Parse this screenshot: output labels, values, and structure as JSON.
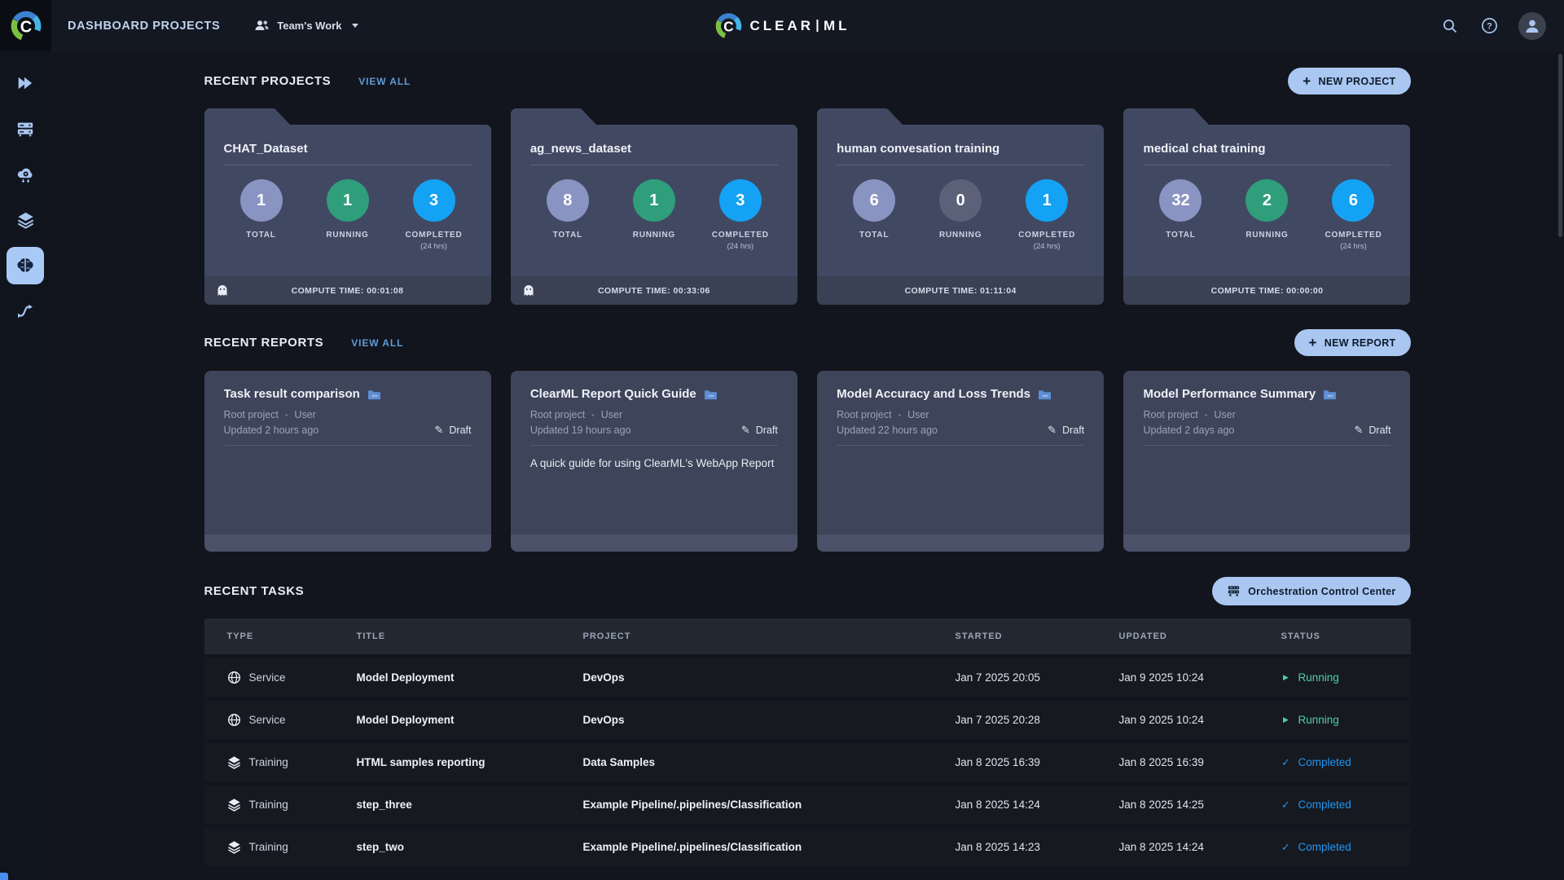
{
  "topbar": {
    "page_title": "DASHBOARD PROJECTS",
    "workspace": {
      "label": "Team's Work",
      "icon": "people-icon",
      "caret": "chevron-down-icon"
    },
    "logo": {
      "icon": "clearml-logo-icon",
      "text_left": "CLEAR",
      "text_right": "ML"
    },
    "icons": {
      "search": "search-icon",
      "help": "help-icon",
      "avatar": "user-avatar-icon"
    }
  },
  "sidebar": {
    "items": [
      {
        "name": "getting-started",
        "icon": "double-play-icon",
        "active": false
      },
      {
        "name": "workers-queues",
        "icon": "server-rack-icon",
        "active": false
      },
      {
        "name": "applications",
        "icon": "cloud-gear-icon",
        "active": false
      },
      {
        "name": "datasets",
        "icon": "layers-icon",
        "active": false
      },
      {
        "name": "models",
        "icon": "brain-icon",
        "active": true
      },
      {
        "name": "pipelines",
        "icon": "pipeline-icon",
        "active": false
      }
    ]
  },
  "projects": {
    "title": "RECENT PROJECTS",
    "view_all": "VIEW ALL",
    "new_button": "NEW PROJECT",
    "plus_icon": "plus-icon",
    "ghost_icon": "ghost-icon",
    "labels": {
      "total": "TOTAL",
      "running": "RUNNING",
      "completed": "COMPLETED",
      "completed_note": "(24 hrs)"
    },
    "cards": [
      {
        "title": "CHAT_Dataset",
        "total": "1",
        "running": "1",
        "completed": "3",
        "compute_time": "COMPUTE TIME: 00:01:08",
        "ghost": true
      },
      {
        "title": "ag_news_dataset",
        "total": "8",
        "running": "1",
        "completed": "3",
        "compute_time": "COMPUTE TIME: 00:33:06",
        "ghost": true
      },
      {
        "title": "human convesation training",
        "total": "6",
        "running": "0",
        "completed": "1",
        "compute_time": "COMPUTE TIME: 01:11:04",
        "ghost": false
      },
      {
        "title": "medical chat training",
        "total": "32",
        "running": "2",
        "completed": "6",
        "compute_time": "COMPUTE TIME: 00:00:00",
        "ghost": false
      }
    ]
  },
  "reports": {
    "title": "RECENT REPORTS",
    "view_all": "VIEW ALL",
    "new_button": "NEW REPORT",
    "folder_icon": "report-folder-icon",
    "draft_icon": "pencil-icon",
    "cards": [
      {
        "title": "Task result comparison",
        "project": "Root project",
        "author": "User",
        "updated": "Updated 2 hours ago",
        "status": "Draft",
        "description": ""
      },
      {
        "title": "ClearML Report Quick Guide",
        "project": "Root project",
        "author": "User",
        "updated": "Updated 19 hours ago",
        "status": "Draft",
        "description": "A quick guide for using ClearML's WebApp Report"
      },
      {
        "title": "Model Accuracy and Loss Trends",
        "project": "Root project",
        "author": "User",
        "updated": "Updated 22 hours ago",
        "status": "Draft",
        "description": ""
      },
      {
        "title": "Model Performance Summary",
        "project": "Root project",
        "author": "User",
        "updated": "Updated 2 days ago",
        "status": "Draft",
        "description": ""
      }
    ]
  },
  "tasks": {
    "title": "RECENT TASKS",
    "button": "Orchestration Control Center",
    "button_icon": "orchestration-icon",
    "headers": [
      "TYPE",
      "TITLE",
      "PROJECT",
      "STARTED",
      "UPDATED",
      "STATUS"
    ],
    "rows": [
      {
        "type": "Service",
        "type_icon": "globe-icon",
        "title": "Model Deployment",
        "project": "DevOps",
        "started": "Jan 7 2025 20:05",
        "updated": "Jan 9 2025 10:24",
        "status": "Running",
        "status_kind": "running",
        "status_icon": "play-icon"
      },
      {
        "type": "Service",
        "type_icon": "globe-icon",
        "title": "Model Deployment",
        "project": "DevOps",
        "started": "Jan 7 2025 20:28",
        "updated": "Jan 9 2025 10:24",
        "status": "Running",
        "status_kind": "running",
        "status_icon": "play-icon"
      },
      {
        "type": "Training",
        "type_icon": "layers-icon",
        "title": "HTML samples reporting",
        "project": "Data Samples",
        "started": "Jan 8 2025 16:39",
        "updated": "Jan 8 2025 16:39",
        "status": "Completed",
        "status_kind": "completed",
        "status_icon": "check-icon"
      },
      {
        "type": "Training",
        "type_icon": "layers-icon",
        "title": "step_three",
        "project": "Example Pipeline/.pipelines/Classification",
        "started": "Jan 8 2025 14:24",
        "updated": "Jan 8 2025 14:25",
        "status": "Completed",
        "status_kind": "completed",
        "status_icon": "check-icon"
      },
      {
        "type": "Training",
        "type_icon": "layers-icon",
        "title": "step_two",
        "project": "Example Pipeline/.pipelines/Classification",
        "started": "Jan 8 2025 14:23",
        "updated": "Jan 8 2025 14:24",
        "status": "Completed",
        "status_kind": "completed",
        "status_icon": "check-icon"
      }
    ]
  },
  "colors": {
    "accent_blue": "#2196f3",
    "running_green": "#4fd0a2",
    "button_bg": "#a9c7f1",
    "total_circle": "#8a94c2",
    "running_circle": "#2f9e7b",
    "zero_circle": "#5b6179",
    "completed_circle": "#14a2f5",
    "card_bg": "#414962",
    "report_card_bg": "#3e455a"
  }
}
